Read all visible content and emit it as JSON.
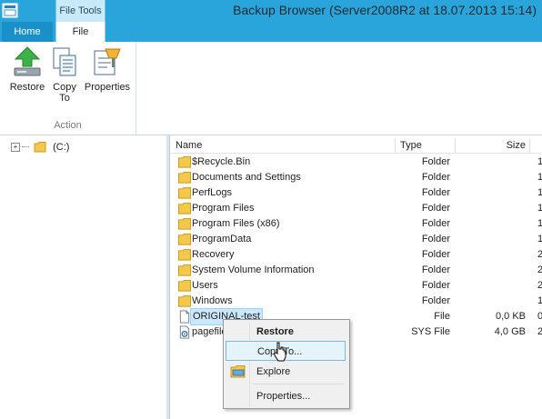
{
  "window": {
    "title": "Backup Browser (Server2008R2 at 18.07.2013 15:14)",
    "contextual_tab_header": "File Tools"
  },
  "tabs": [
    {
      "label": "Home"
    },
    {
      "label": "File"
    }
  ],
  "ribbon": {
    "buttons": [
      {
        "label": "Restore",
        "icon": "restore-icon"
      },
      {
        "label": "Copy\nTo",
        "icon": "copy-to-icon"
      },
      {
        "label": "Properties",
        "icon": "properties-icon"
      }
    ],
    "group_label": "Action"
  },
  "tree": {
    "expander": "+",
    "root_label": "(C:)"
  },
  "columns": {
    "name": "Name",
    "type": "Type",
    "size": "Size"
  },
  "files": [
    {
      "name": "$Recycle.Bin",
      "type": "Folder",
      "size": "",
      "extra": "1",
      "icon": "folder-icon"
    },
    {
      "name": "Documents and Settings",
      "type": "Folder",
      "size": "",
      "extra": "1",
      "icon": "folder-icon"
    },
    {
      "name": "PerfLogs",
      "type": "Folder",
      "size": "",
      "extra": "1",
      "icon": "folder-icon"
    },
    {
      "name": "Program Files",
      "type": "Folder",
      "size": "",
      "extra": "1",
      "icon": "folder-icon"
    },
    {
      "name": "Program Files (x86)",
      "type": "Folder",
      "size": "",
      "extra": "1",
      "icon": "folder-icon"
    },
    {
      "name": "ProgramData",
      "type": "Folder",
      "size": "",
      "extra": "1",
      "icon": "folder-icon"
    },
    {
      "name": "Recovery",
      "type": "Folder",
      "size": "",
      "extra": "2",
      "icon": "folder-icon"
    },
    {
      "name": "System Volume Information",
      "type": "Folder",
      "size": "",
      "extra": "2",
      "icon": "folder-icon"
    },
    {
      "name": "Users",
      "type": "Folder",
      "size": "",
      "extra": "2",
      "icon": "folder-icon"
    },
    {
      "name": "Windows",
      "type": "Folder",
      "size": "",
      "extra": "1",
      "icon": "folder-icon"
    },
    {
      "name": "ORIGINAL-test",
      "type": "File",
      "size": "0,0 KB",
      "extra": "0",
      "icon": "file-icon",
      "selected": true
    },
    {
      "name": "pagefile",
      "type": "SYS File",
      "size": "4,0 GB",
      "extra": "2",
      "icon": "sys-file-icon"
    }
  ],
  "context_menu": {
    "items": [
      {
        "label": "Restore",
        "bold": true
      },
      {
        "label": "Copy To...",
        "hover": true
      },
      {
        "label": "Explore",
        "icon": "explore-icon"
      },
      {
        "label": "Properties..."
      }
    ]
  }
}
